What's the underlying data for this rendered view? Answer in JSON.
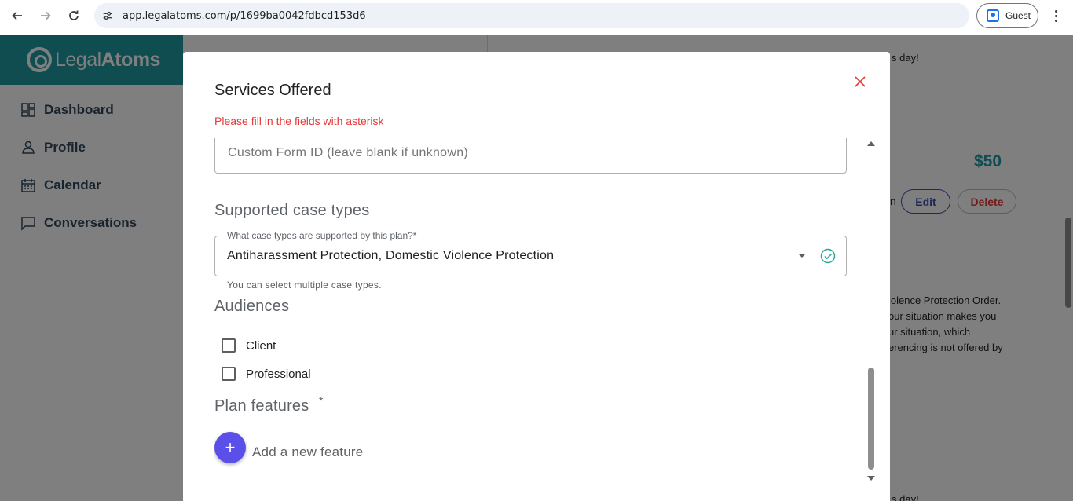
{
  "browser": {
    "url": "app.legalatoms.com/p/1699ba0042fdbcd153d6",
    "profile_label": "Guest"
  },
  "sidebar": {
    "brand_light": "Legal",
    "brand_bold": "Atoms",
    "items": [
      {
        "label": "Dashboard",
        "icon": "dashboard-icon"
      },
      {
        "label": "Profile",
        "icon": "person-icon"
      },
      {
        "label": "Calendar",
        "icon": "calendar-icon"
      },
      {
        "label": "Conversations",
        "icon": "chat-icon"
      }
    ]
  },
  "background": {
    "snippet_top": "s day!",
    "price": "$50",
    "snippet_n": "n",
    "edit_label": "Edit",
    "delete_label": "Delete",
    "desc_lines": [
      "iolence Protection Order.",
      "our situation makes you",
      "ur situation, which",
      "erencing is not offered by"
    ],
    "snippet_bottom": "s day!"
  },
  "modal": {
    "title": "Services Offered",
    "warning": "Please fill in the fields with asterisk",
    "custom_form_placeholder": "Custom Form ID (leave blank if unknown)",
    "case_types_heading": "Supported case types",
    "case_types_label": "What case types are supported by this plan?*",
    "case_types_value": "Antiharassment Protection, Domestic Violence Protection",
    "case_types_helper": "You can select multiple case types.",
    "audiences_heading": "Audiences",
    "audiences": [
      {
        "label": "Client",
        "checked": false
      },
      {
        "label": "Professional",
        "checked": false
      }
    ],
    "plan_features_heading": "Plan features",
    "plan_features_asterisk": "*",
    "add_feature_label": "Add a new feature",
    "add_feature_icon": "+"
  },
  "colors": {
    "brand_teal": "#1f9aa3",
    "error_red": "#e53935",
    "fab_purple": "#5a4fe8",
    "success_teal": "#26a69a"
  }
}
